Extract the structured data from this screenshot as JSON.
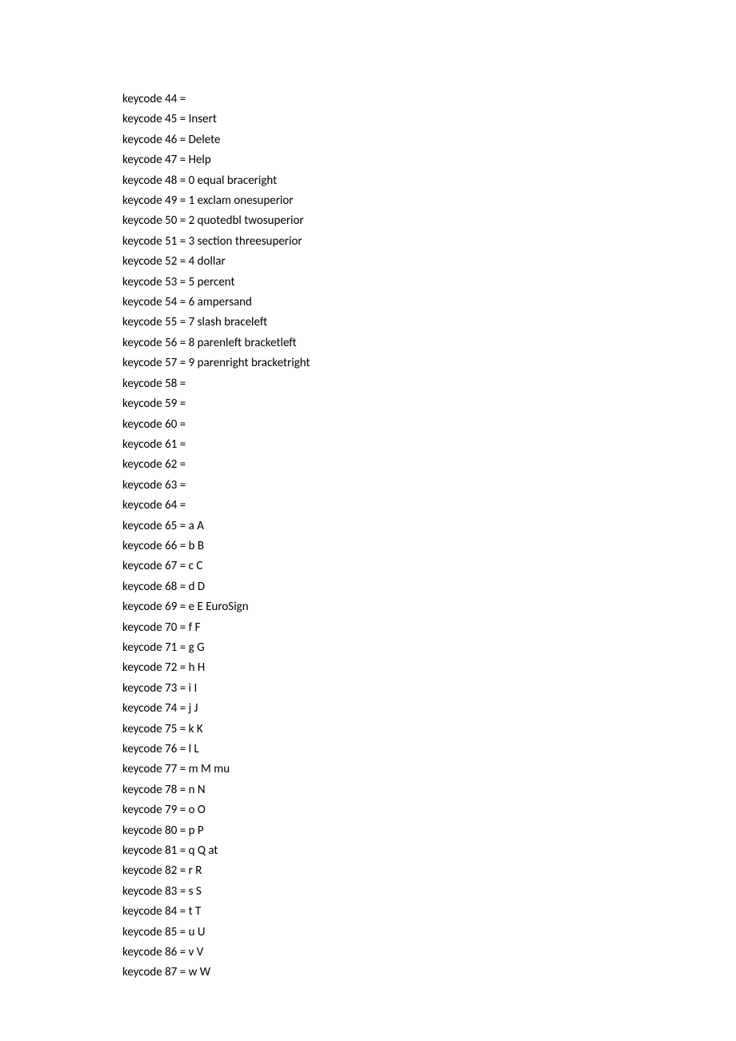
{
  "lines": [
    "keycode 44 =",
    "keycode 45 = Insert",
    "keycode 46 = Delete",
    "keycode 47 = Help",
    "keycode 48 = 0 equal braceright",
    "keycode 49 = 1 exclam onesuperior",
    "keycode 50 = 2 quotedbl twosuperior",
    "keycode 51 = 3 section threesuperior",
    "keycode 52 = 4 dollar",
    "keycode 53 = 5 percent",
    "keycode 54 = 6 ampersand",
    "keycode 55 = 7 slash braceleft",
    "keycode 56 = 8 parenleft bracketleft",
    "keycode 57 = 9 parenright bracketright",
    "keycode 58 =",
    "keycode 59 =",
    "keycode 60 =",
    "keycode 61 =",
    "keycode 62 =",
    "keycode 63 =",
    "keycode 64 =",
    "keycode 65 = a A",
    "keycode 66 = b B",
    "keycode 67 = c C",
    "keycode 68 = d D",
    "keycode 69 = e E EuroSign",
    "keycode 70 = f F",
    "keycode 71 = g G",
    "keycode 72 = h H",
    "keycode 73 = i I",
    "keycode 74 = j J",
    "keycode 75 = k K",
    "keycode 76 = l L",
    "keycode 77 = m M mu",
    "keycode 78 = n N",
    "keycode 79 = o O",
    "keycode 80 = p P",
    "keycode 81 = q Q at",
    "keycode 82 = r R",
    "keycode 83 = s S",
    "keycode 84 = t T",
    "keycode 85 = u U",
    "keycode 86 = v V",
    "keycode 87 = w W"
  ]
}
